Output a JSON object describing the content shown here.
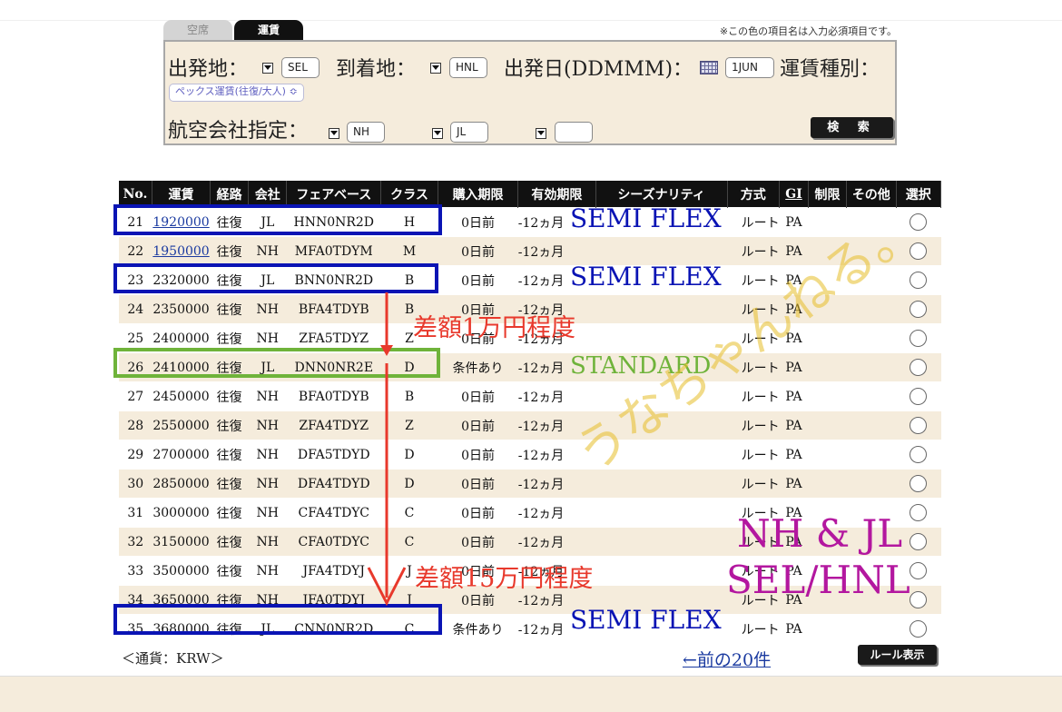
{
  "search": {
    "tabs": [
      "空席",
      "運賃"
    ],
    "note": "※この色の項目名は入力必須項目です。",
    "origin_label": "出発地：",
    "origin": "SEL",
    "dest_label": "到着地：",
    "dest": "HNL",
    "date_label": "出発日(DDMMM)：",
    "date": "1JUN",
    "fare_type_label": "運賃種別：",
    "fare_type": "ペックス運賃(往復/大人) ≎",
    "airline_label": "航空会社指定：",
    "airlines": [
      "NH",
      "JL",
      ""
    ],
    "search_button": "検 索"
  },
  "table": {
    "headers": [
      "No.",
      "運賃",
      "経路",
      "会社",
      "フェアベース",
      "クラス",
      "購入期限",
      "有効期限",
      "シーズナリティ",
      "方式",
      "GI",
      "制限",
      "その他",
      "選択"
    ],
    "rows": [
      {
        "no": "21",
        "fare": "1920000",
        "route": "往復",
        "airline": "JL",
        "basis": "HNN0NR2D",
        "cls": "H",
        "purchase": "0日前",
        "valid": "-12ヵ月",
        "method": "ルート",
        "gi": "PA",
        "link": true
      },
      {
        "no": "22",
        "fare": "1950000",
        "route": "往復",
        "airline": "NH",
        "basis": "MFA0TDYM",
        "cls": "M",
        "purchase": "0日前",
        "valid": "-12ヵ月",
        "method": "ルート",
        "gi": "PA",
        "link": true
      },
      {
        "no": "23",
        "fare": "2320000",
        "route": "往復",
        "airline": "JL",
        "basis": "BNN0NR2D",
        "cls": "B",
        "purchase": "0日前",
        "valid": "-12ヵ月",
        "method": "ルート",
        "gi": "PA",
        "link": false
      },
      {
        "no": "24",
        "fare": "2350000",
        "route": "往復",
        "airline": "NH",
        "basis": "BFA4TDYB",
        "cls": "B",
        "purchase": "0日前",
        "valid": "-12ヵ月",
        "method": "ルート",
        "gi": "PA",
        "link": false
      },
      {
        "no": "25",
        "fare": "2400000",
        "route": "往復",
        "airline": "NH",
        "basis": "ZFA5TDYZ",
        "cls": "Z",
        "purchase": "0日前",
        "valid": "-12ヵ月",
        "method": "ルート",
        "gi": "PA",
        "link": false
      },
      {
        "no": "26",
        "fare": "2410000",
        "route": "往復",
        "airline": "JL",
        "basis": "DNN0NR2E",
        "cls": "D",
        "purchase": "条件あり",
        "valid": "-12ヵ月",
        "method": "ルート",
        "gi": "PA",
        "link": false
      },
      {
        "no": "27",
        "fare": "2450000",
        "route": "往復",
        "airline": "NH",
        "basis": "BFA0TDYB",
        "cls": "B",
        "purchase": "0日前",
        "valid": "-12ヵ月",
        "method": "ルート",
        "gi": "PA",
        "link": false
      },
      {
        "no": "28",
        "fare": "2550000",
        "route": "往復",
        "airline": "NH",
        "basis": "ZFA4TDYZ",
        "cls": "Z",
        "purchase": "0日前",
        "valid": "-12ヵ月",
        "method": "ルート",
        "gi": "PA",
        "link": false
      },
      {
        "no": "29",
        "fare": "2700000",
        "route": "往復",
        "airline": "NH",
        "basis": "DFA5TDYD",
        "cls": "D",
        "purchase": "0日前",
        "valid": "-12ヵ月",
        "method": "ルート",
        "gi": "PA",
        "link": false
      },
      {
        "no": "30",
        "fare": "2850000",
        "route": "往復",
        "airline": "NH",
        "basis": "DFA4TDYD",
        "cls": "D",
        "purchase": "0日前",
        "valid": "-12ヵ月",
        "method": "ルート",
        "gi": "PA",
        "link": false
      },
      {
        "no": "31",
        "fare": "3000000",
        "route": "往復",
        "airline": "NH",
        "basis": "CFA4TDYC",
        "cls": "C",
        "purchase": "0日前",
        "valid": "-12ヵ月",
        "method": "ルート",
        "gi": "PA",
        "link": false
      },
      {
        "no": "32",
        "fare": "3150000",
        "route": "往復",
        "airline": "NH",
        "basis": "CFA0TDYC",
        "cls": "C",
        "purchase": "0日前",
        "valid": "-12ヵ月",
        "method": "ルート",
        "gi": "PA",
        "link": false
      },
      {
        "no": "33",
        "fare": "3500000",
        "route": "往復",
        "airline": "NH",
        "basis": "JFA4TDYJ",
        "cls": "J",
        "purchase": "0日前",
        "valid": "-12ヵ月",
        "method": "ルート",
        "gi": "PA",
        "link": false
      },
      {
        "no": "34",
        "fare": "3650000",
        "route": "往復",
        "airline": "NH",
        "basis": "JFA0TDYJ",
        "cls": "J",
        "purchase": "0日前",
        "valid": "-12ヵ月",
        "method": "ルート",
        "gi": "PA",
        "link": false
      },
      {
        "no": "35",
        "fare": "3680000",
        "route": "往復",
        "airline": "JL",
        "basis": "CNN0NR2D",
        "cls": "C",
        "purchase": "条件あり",
        "valid": "-12ヵ月",
        "method": "ルート",
        "gi": "PA",
        "link": false
      }
    ]
  },
  "footer": {
    "currency": "＜通貨：KRW＞",
    "prev": "←前の20件",
    "rule_button": "ルール表示"
  },
  "annotations": {
    "semi_flex": "SEMI FLEX",
    "standard": "STANDARD",
    "diff1": "差額1万円程度",
    "diff2": "差額15万円程度",
    "nh_jl": "NH & JL",
    "route": "SEL/HNL",
    "watermark": "うなちゃんねる。",
    "colors": {
      "blue": "#0a14b4",
      "green": "#6fb33a",
      "red": "#e8392c",
      "magenta": "#b3179f",
      "watermark": "#e6be28"
    }
  }
}
